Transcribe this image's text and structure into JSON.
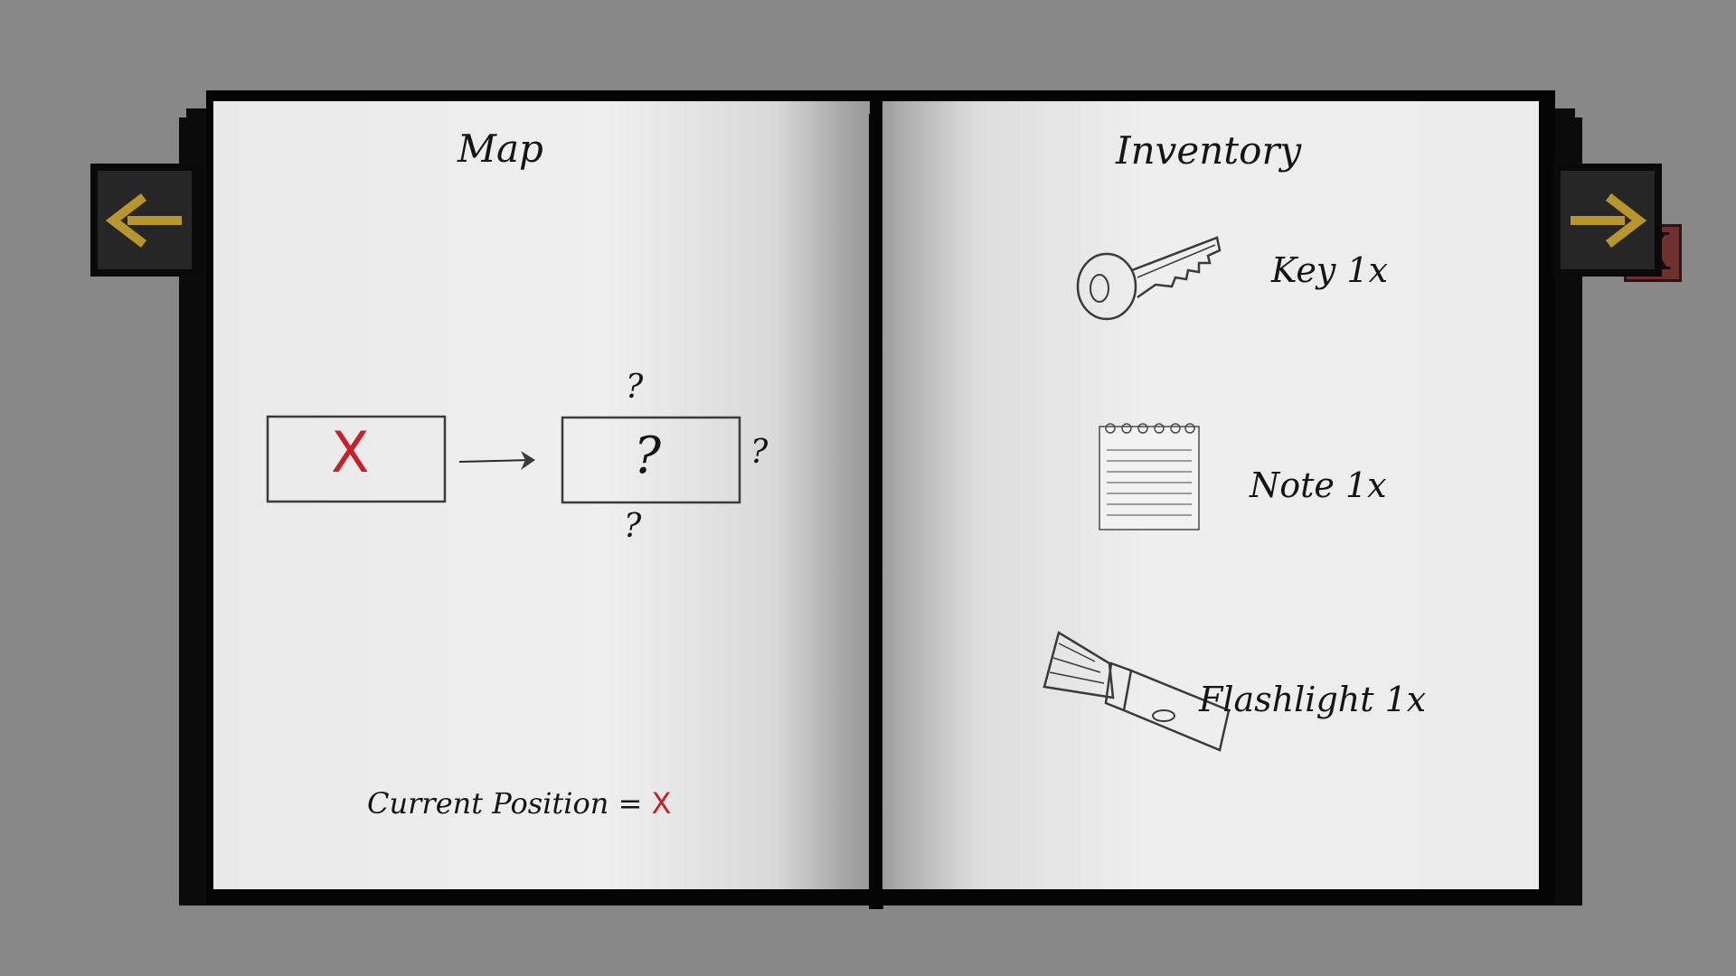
{
  "left_page": {
    "title": "Map",
    "current_room_mark": "X",
    "unknown_room_mark": "?",
    "unknown_exits": [
      "?",
      "?",
      "?"
    ],
    "legend_label": "Current Position =",
    "legend_mark": "X"
  },
  "right_page": {
    "title": "Inventory",
    "close_label": "X",
    "items": [
      {
        "icon": "key-icon",
        "label": "Key 1x"
      },
      {
        "icon": "note-icon",
        "label": "Note 1x"
      },
      {
        "icon": "flashlight-icon",
        "label": "Flashlight 1x"
      }
    ]
  },
  "nav": {
    "prev_icon": "arrow-left-icon",
    "next_icon": "arrow-right-icon"
  },
  "colors": {
    "background": "#878787",
    "paper": "#ececec",
    "arrow_gold": "#b8952d",
    "close_red": "#6e2f2f",
    "mark_red": "#c8202a"
  }
}
